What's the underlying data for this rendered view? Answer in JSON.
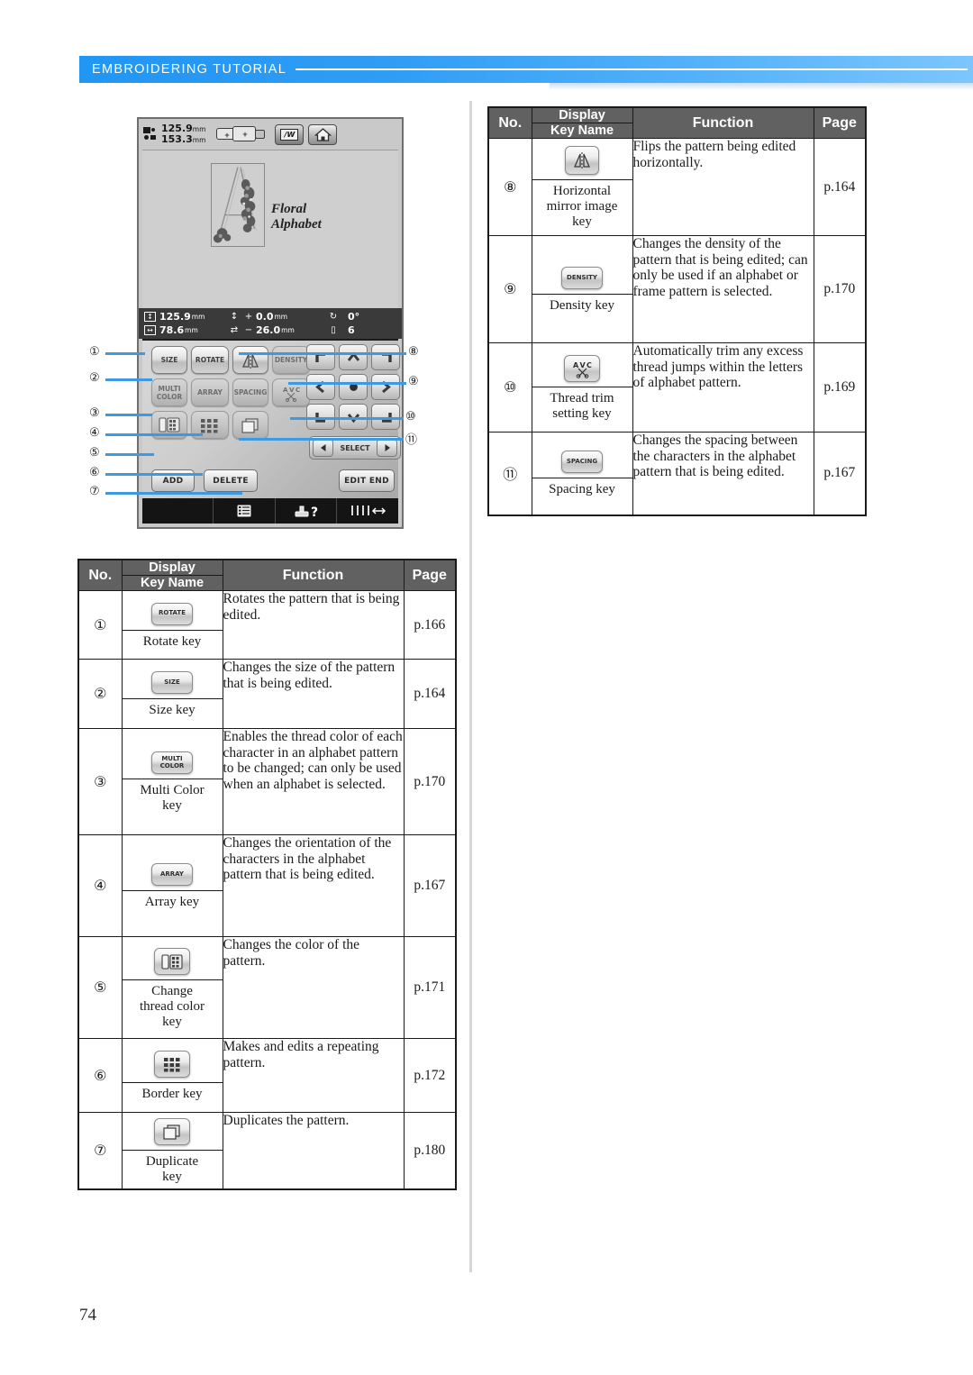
{
  "header": {
    "title": "EMBROIDERING TUTORIAL"
  },
  "page_number": "74",
  "machine_screen": {
    "top_bar": {
      "hoop_height": "125.9",
      "hoop_width": "153.3",
      "unit": "mm",
      "hoop_icon": "hoop-size-icon",
      "needle_button": "needle-mode-button",
      "home_button": "home-button"
    },
    "preview": {
      "pattern_label_line1": "Floral",
      "pattern_label_line2": "Alphabet",
      "letter": "A"
    },
    "status_bar": {
      "height_value": "125.9",
      "height_unit": "mm",
      "width_value": "78.6",
      "width_unit": "mm",
      "v_offset_sign": "+",
      "v_offset_value": "0.0",
      "v_offset_unit": "mm",
      "h_offset_sign": "−",
      "h_offset_value": "26.0",
      "h_offset_unit": "mm",
      "rotation_value": "0",
      "rotation_unit": "°",
      "thread_count": "6"
    },
    "keys": {
      "size": "SIZE",
      "rotate": "ROTATE",
      "mirror": "",
      "density": "DENSITY",
      "multi_color_line1": "MULTI",
      "multi_color_line2": "COLOR",
      "array": "ARRAY",
      "spacing": "SPACING",
      "thread_trim": "",
      "change_thread_color": "",
      "border": "",
      "duplicate": "",
      "select": "SELECT",
      "add": "ADD",
      "delete": "DELETE",
      "edit_end": "EDIT END"
    },
    "callouts_left": [
      "①",
      "②",
      "③",
      "④",
      "⑤",
      "⑥",
      "⑦"
    ],
    "callouts_right": [
      "⑧",
      "⑨",
      "⑩",
      "⑪"
    ]
  },
  "table_headers": {
    "no": "No.",
    "display": "Display",
    "key_name": "Key Name",
    "function": "Function",
    "page": "Page"
  },
  "table_right": {
    "rows": [
      {
        "no": "⑧",
        "icon": "horizontal-mirror-icon",
        "icon_label": "",
        "key_name": "Horizontal\nmirror image\nkey",
        "function": "Flips the pattern being edited horizontally.",
        "page": "p.164"
      },
      {
        "no": "⑨",
        "icon": "density-icon",
        "icon_label": "DENSITY",
        "key_name": "Density key",
        "function": "Changes the density of the pattern that is being edited; can only be used if an alphabet or frame pattern is selected.",
        "page": "p.170"
      },
      {
        "no": "⑩",
        "icon": "thread-trim-icon",
        "icon_label": "",
        "key_name": "Thread trim\nsetting key",
        "function": "Automatically trim any excess thread jumps within the letters of alphabet pattern.",
        "page": "p.169"
      },
      {
        "no": "⑪",
        "icon": "spacing-icon",
        "icon_label": "SPACING",
        "key_name": "Spacing key",
        "function": "Changes the spacing between the characters in the alphabet pattern that is being edited.",
        "page": "p.167"
      }
    ]
  },
  "table_left": {
    "rows": [
      {
        "no": "①",
        "icon": "rotate-icon",
        "icon_label": "ROTATE",
        "key_name": "Rotate key",
        "function": "Rotates the pattern that is being edited.",
        "page": "p.166"
      },
      {
        "no": "②",
        "icon": "size-icon",
        "icon_label": "SIZE",
        "key_name": "Size key",
        "function": "Changes the size of the pattern that is being edited.",
        "page": "p.164"
      },
      {
        "no": "③",
        "icon": "multi-color-icon",
        "icon_label": "MULTI\nCOLOR",
        "key_name": "Multi Color\nkey",
        "function": "Enables the thread color of each character in an alphabet pattern to be changed; can only be used when an alphabet is selected.",
        "page": "p.170"
      },
      {
        "no": "④",
        "icon": "array-icon",
        "icon_label": "ARRAY",
        "key_name": "Array key",
        "function": "Changes the orientation of the characters in the alphabet pattern that is being edited.",
        "page": "p.167"
      },
      {
        "no": "⑤",
        "icon": "change-thread-color-icon",
        "icon_label": "",
        "key_name": "Change\nthread color\nkey",
        "function": "Changes the color of the pattern.",
        "page": "p.171"
      },
      {
        "no": "⑥",
        "icon": "border-icon",
        "icon_label": "",
        "key_name": "Border key",
        "function": "Makes and edits a repeating pattern.",
        "page": "p.172"
      },
      {
        "no": "⑦",
        "icon": "duplicate-icon",
        "icon_label": "",
        "key_name": "Duplicate\nkey",
        "function": "Duplicates the pattern.",
        "page": "p.180"
      }
    ]
  },
  "colors": {
    "header_blue": "#2196f3",
    "table_header_gray": "#616161",
    "callout_line": "#3d9ae2"
  }
}
